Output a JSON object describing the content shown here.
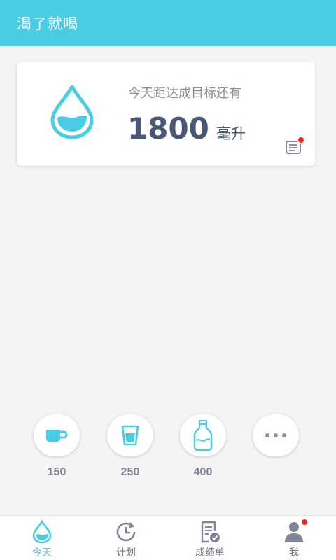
{
  "header": {
    "title": "渴了就喝"
  },
  "card": {
    "hint": "今天距达成目标还有",
    "amount": "1800",
    "unit": "毫升"
  },
  "quick": [
    {
      "icon": "cup-icon",
      "label": "150"
    },
    {
      "icon": "glass-icon",
      "label": "250"
    },
    {
      "icon": "bottle-icon",
      "label": "400"
    },
    {
      "icon": "more-icon",
      "label": ""
    }
  ],
  "tabs": [
    {
      "icon": "water-drop-icon",
      "label": "今天"
    },
    {
      "icon": "clock-icon",
      "label": "计划"
    },
    {
      "icon": "report-icon",
      "label": "成绩单"
    },
    {
      "icon": "person-icon",
      "label": "我"
    }
  ],
  "colors": {
    "accent": "#48cde4",
    "text_dark": "#4a5877",
    "text_gray": "#8a8f9a",
    "badge": "#ff1a1a"
  }
}
